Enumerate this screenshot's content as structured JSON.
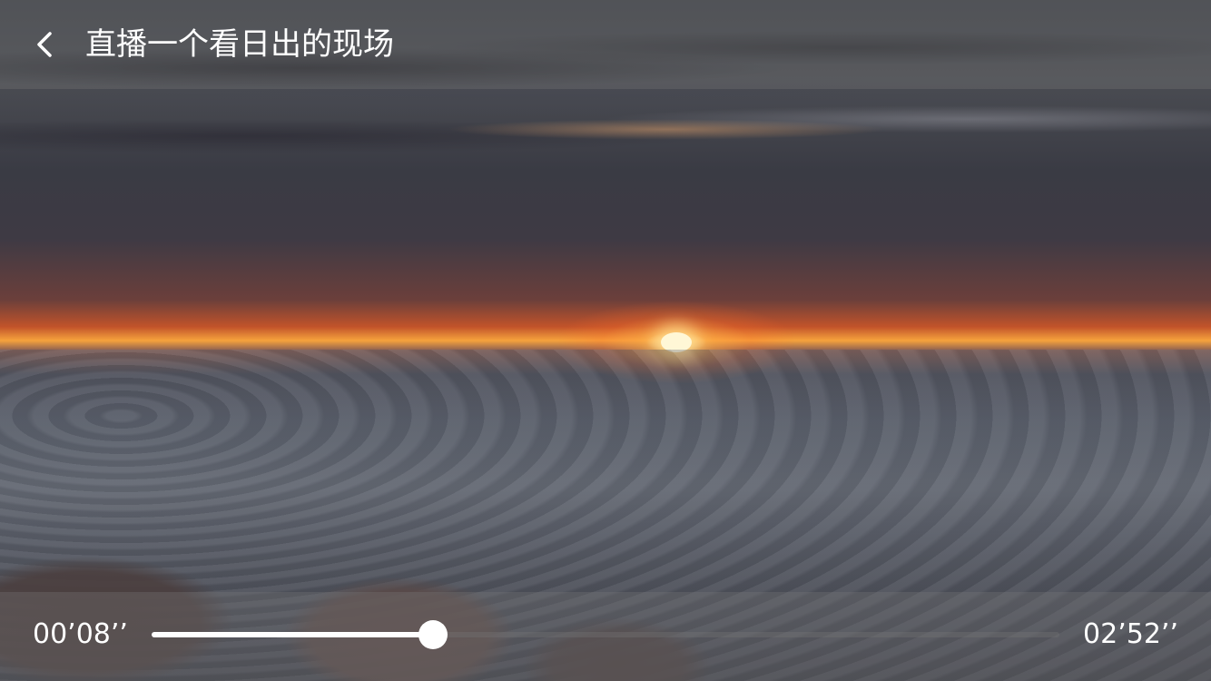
{
  "header": {
    "back_icon": "chevron-left-icon",
    "title": "直播一个看日出的现场"
  },
  "player": {
    "elapsed": "00’08’’",
    "total": "02’52’’",
    "progress_fraction": 0.31
  },
  "colors": {
    "text": "#FFFFFF",
    "bar_background": "#7C7C7C",
    "bar_opacity": 0.3,
    "progress_fill": "#FFFFFF",
    "thumb": "#FFFFFF"
  }
}
